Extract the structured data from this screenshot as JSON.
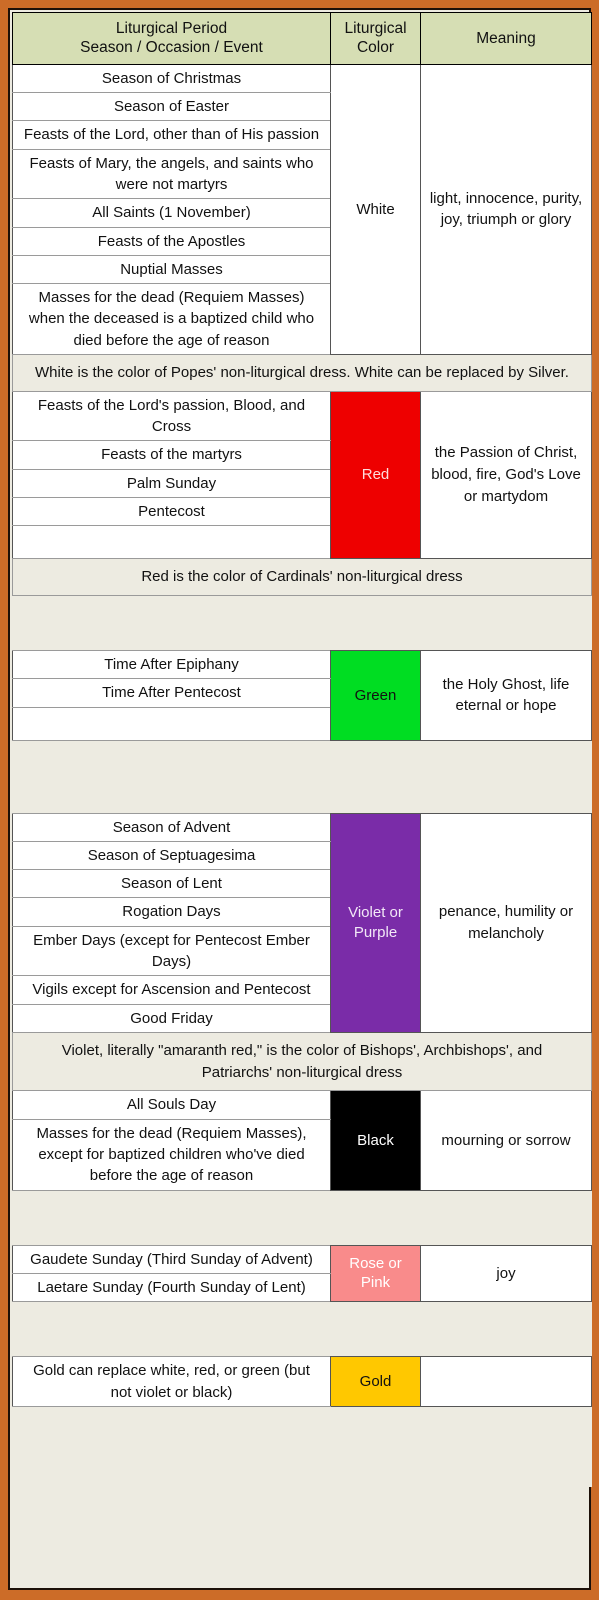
{
  "table": {
    "header": {
      "period_line1": "Liturgical Period",
      "period_line2": "Season / Occasion / Event",
      "color_line1": "Liturgical",
      "color_line2": "Color",
      "meaning": "Meaning"
    },
    "sections": [
      {
        "color_name": "White",
        "color_hex": "#FFFFFF",
        "color_text_hex": "#111111",
        "meaning": "light, innocence, purity, joy, triumph or glory",
        "periods": [
          "Season of Christmas",
          "Season of Easter",
          "Feasts of the Lord, other than of His passion",
          "Feasts of Mary, the angels, and saints who were not martyrs",
          "All Saints (1 November)",
          "Feasts of the Apostles",
          "Nuptial Masses",
          "Masses for the dead (Requiem Masses) when the deceased is a baptized child who died before the age of reason"
        ],
        "note": "White is the color of Popes' non-liturgical dress. White can be replaced by Silver."
      },
      {
        "color_name": "Red",
        "color_hex": "#EE0000",
        "color_text_hex": "#FFDDDD",
        "meaning": "the Passion of Christ, blood, fire, God's Love or martydom",
        "periods": [
          "Feasts of the Lord's passion, Blood, and Cross",
          "Feasts of the martyrs",
          "Palm Sunday",
          "Pentecost",
          ""
        ],
        "note": "Red is the color of Cardinals' non-liturgical dress"
      },
      {
        "color_name": "Green",
        "color_hex": "#00DD22",
        "color_text_hex": "#111111",
        "meaning": "the Holy Ghost, life eternal or hope",
        "periods": [
          "Time After Epiphany",
          "Time After Pentecost",
          ""
        ],
        "note": ""
      },
      {
        "color_name": "Violet or Purple",
        "color_hex": "#7A2CA8",
        "color_text_hex": "#F2E8F7",
        "meaning": "penance, humility or melancholy",
        "periods": [
          "Season of Advent",
          "Season of Septuagesima",
          "Season of Lent",
          "Rogation Days",
          "Ember Days (except for Pentecost Ember Days)",
          "Vigils except for Ascension and Pentecost",
          "Good Friday"
        ],
        "note": "Violet, literally \"amaranth red,\" is the color of Bishops', Archbishops', and Patriarchs' non-liturgical dress"
      },
      {
        "color_name": "Black",
        "color_hex": "#000000",
        "color_text_hex": "#FFFFFF",
        "meaning": "mourning or sorrow",
        "periods": [
          "All Souls Day",
          "Masses for the dead (Requiem Masses), except for baptized children who've died before the age of reason"
        ],
        "note": ""
      },
      {
        "color_name": "Rose or Pink",
        "color_hex": "#F98B8B",
        "color_text_hex": "#FFFFFF",
        "meaning": "joy",
        "periods": [
          "Gaudete Sunday (Third Sunday of Advent)",
          "Laetare Sunday (Fourth Sunday of Lent)"
        ],
        "note": ""
      },
      {
        "color_name": "Gold",
        "color_hex": "#FFC800",
        "color_text_hex": "#111111",
        "meaning": "",
        "periods": [
          "Gold can replace white, red, or green (but not violet or black)"
        ],
        "note": ""
      }
    ]
  },
  "frame": {
    "outer_hex": "#CC6C28",
    "inner_border_hex": "#1C1008",
    "page_bg_hex": "#EDEBE1",
    "header_bg_hex": "#D6DEB4"
  }
}
